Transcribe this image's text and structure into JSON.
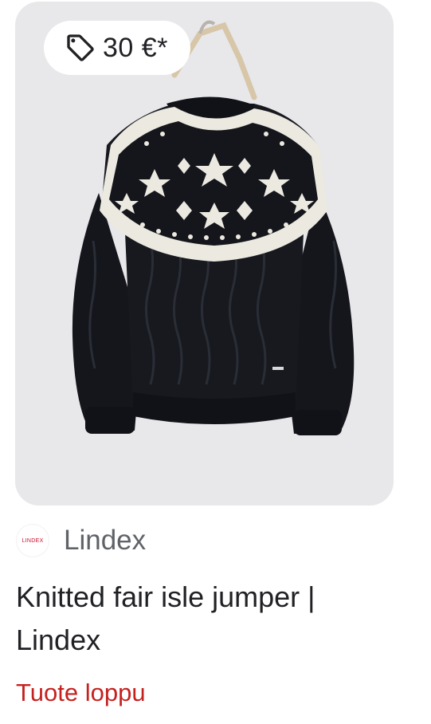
{
  "product_card": {
    "image": {
      "alt": "Knitted fair isle jumper",
      "background_color": "#e8e7ea",
      "garment_color": "#14161c",
      "pattern_color": "#ece9e0"
    },
    "price_chip": {
      "icon": "price-tag-icon",
      "price": "30 €*"
    },
    "merchant": {
      "logo_text": "LINDEX",
      "name": "Lindex",
      "brand_color": "#c8102e"
    },
    "title": "Knitted fair isle jumper | Lindex",
    "status": "Tuote loppu",
    "status_color": "#c5221f"
  }
}
